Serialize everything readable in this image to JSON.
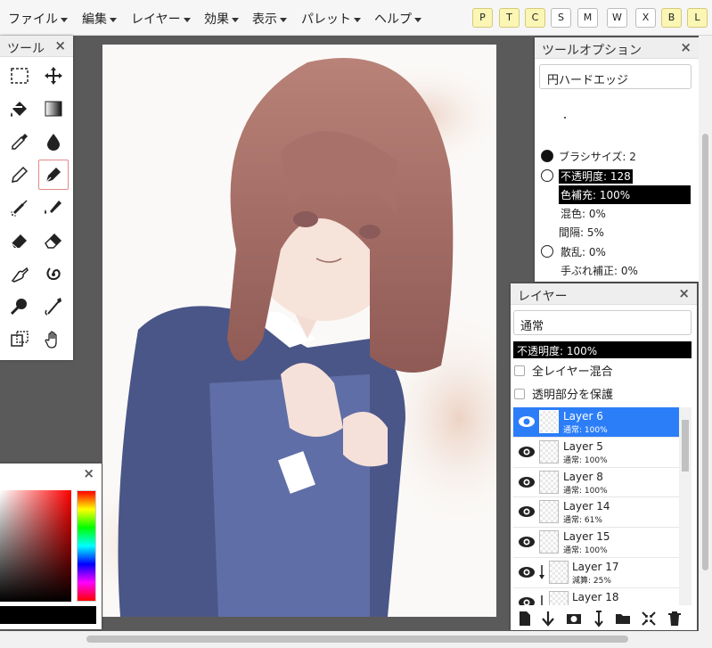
{
  "menubar": {
    "items": [
      "ファイル",
      "編集",
      "レイヤー",
      "効果",
      "表示",
      "パレット",
      "ヘルプ"
    ],
    "quick_buttons": [
      "P",
      "T",
      "C",
      "S",
      "M",
      "W",
      "X",
      "B",
      "L"
    ]
  },
  "tools_panel": {
    "title": "ツール",
    "close": "×",
    "tools": [
      "select-rect",
      "move",
      "fill-bucket",
      "gradient",
      "eyedropper",
      "water-drop",
      "pencil",
      "pen",
      "airbrush",
      "watercolor-brush",
      "eraser",
      "soft-eraser",
      "finger-smudge",
      "swirl-effect",
      "loupe",
      "dodge-burn",
      "copy-canvas",
      "hand"
    ],
    "active_tool": "pen"
  },
  "canvas": {
    "description_colors": {
      "hair": "#a6706a",
      "uniform": "#3d4a7a",
      "skin": "#f3dcd3",
      "background": "#f7f4f1"
    }
  },
  "tool_options": {
    "title": "ツールオプション",
    "close": "×",
    "brush_name": "円ハードエッジ",
    "brush_size_label": "ブラシサイズ: 2",
    "opacity_label": "不透明度: 128",
    "color_fill_label": "色補充: 100%",
    "color_mix_label": "混色: 0%",
    "spacing_label": "間隔: 5%",
    "scatter_label": "散乱: 0%",
    "stabilizer_label": "手ぶれ補正: 0%"
  },
  "layers_panel": {
    "title": "レイヤー",
    "close": "×",
    "blend_mode": "通常",
    "opacity": "不透明度: 100%",
    "merge_all": "全レイヤー混合",
    "protect_alpha": "透明部分を保護",
    "layers": [
      {
        "name": "Layer 6",
        "mode": "通常: 100%",
        "selected": true,
        "clip": false
      },
      {
        "name": "Layer 5",
        "mode": "通常: 100%",
        "selected": false,
        "clip": false
      },
      {
        "name": "Layer 8",
        "mode": "通常: 100%",
        "selected": false,
        "clip": false
      },
      {
        "name": "Layer 14",
        "mode": "通常: 61%",
        "selected": false,
        "clip": false
      },
      {
        "name": "Layer 15",
        "mode": "通常: 100%",
        "selected": false,
        "clip": false
      },
      {
        "name": "Layer 17",
        "mode": "減算: 25%",
        "selected": false,
        "clip": true
      },
      {
        "name": "Layer 18",
        "mode": "",
        "selected": false,
        "clip": true
      }
    ],
    "footer_tools": [
      "new-layer-icon",
      "merge-down-icon",
      "mask-icon",
      "move-layer-icon",
      "folder-icon",
      "collapse-icon",
      "trash-icon"
    ]
  },
  "color_panel": {
    "close": "×",
    "current_color": "#000000",
    "hue_color": "#ff0000"
  }
}
